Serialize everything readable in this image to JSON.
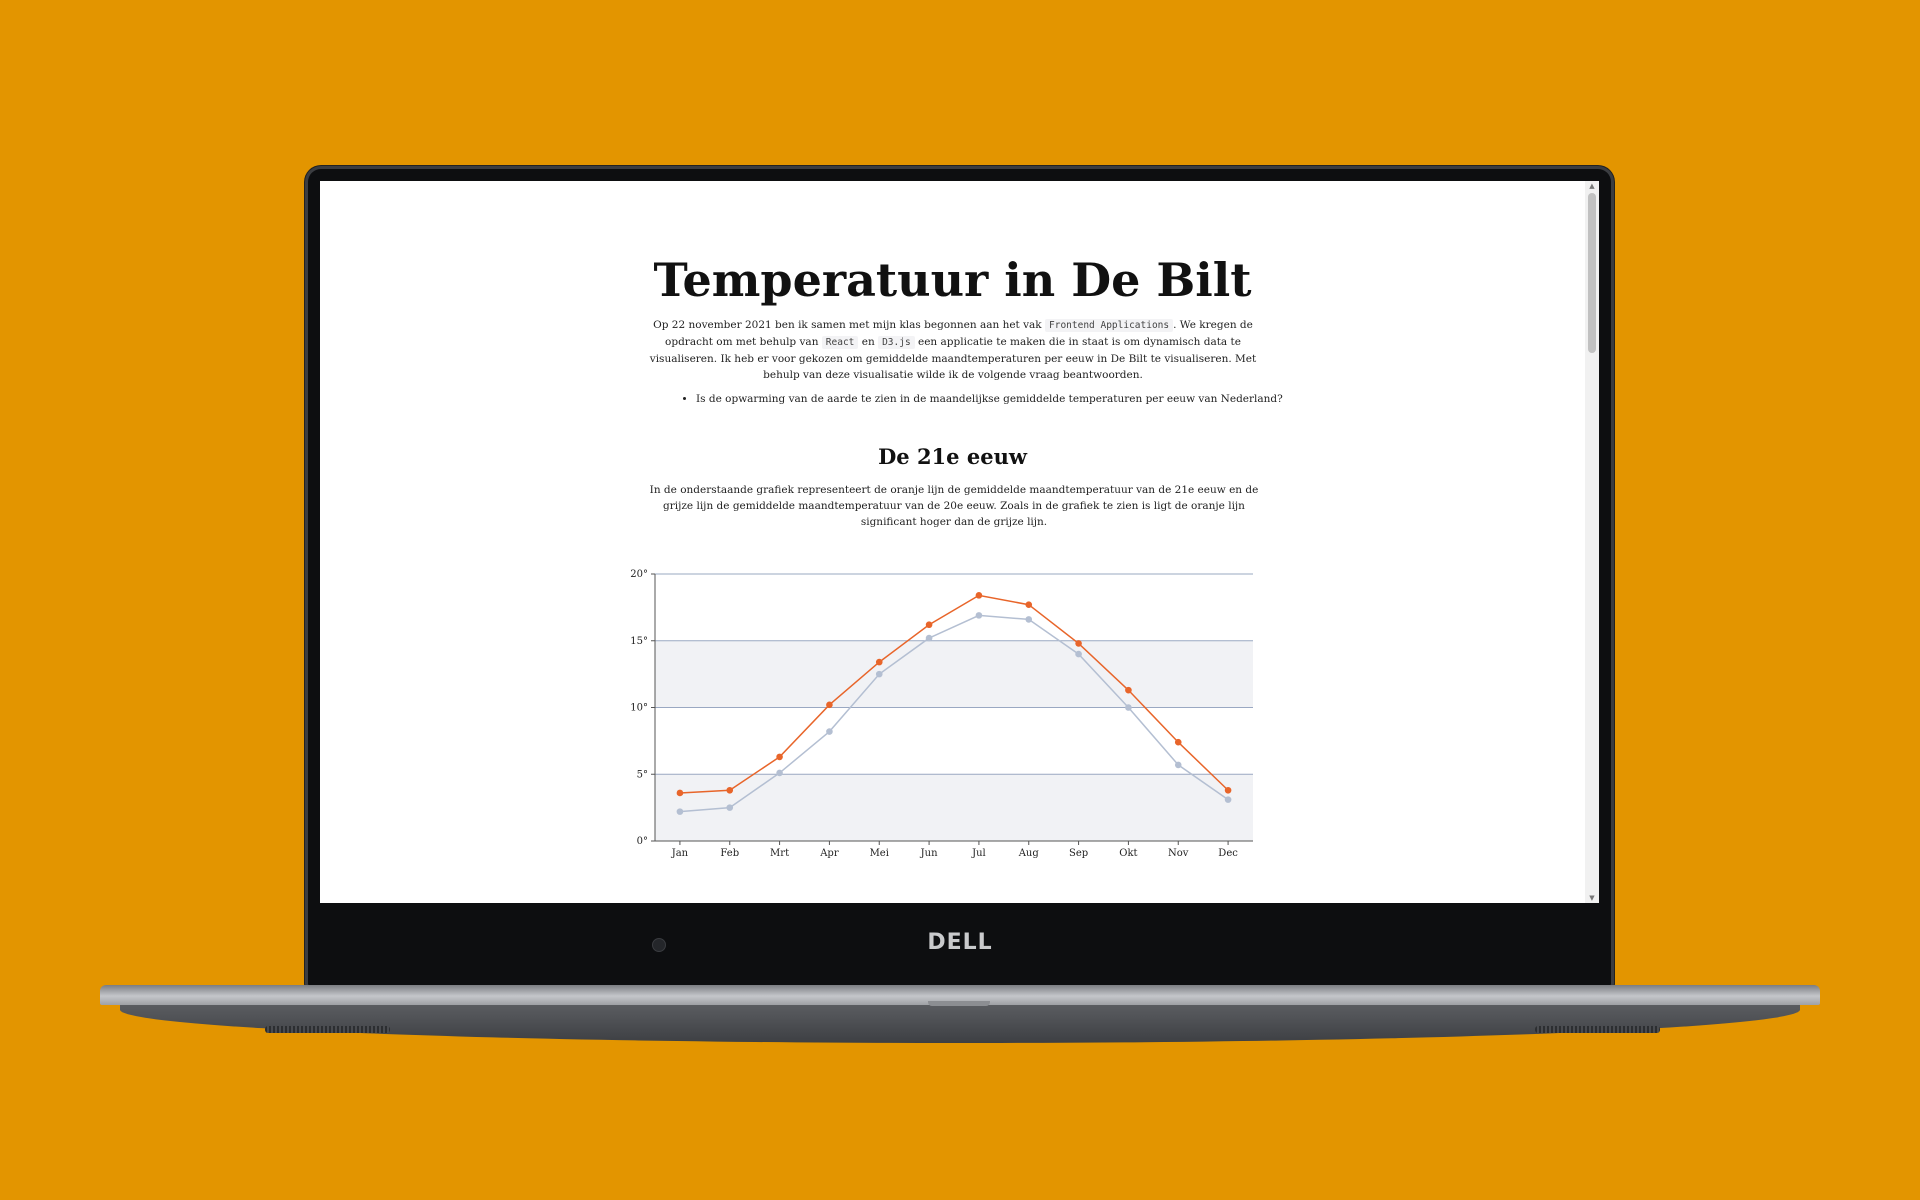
{
  "page": {
    "title": "Temperatuur in De Bilt",
    "intro": {
      "before_code1": "Op 22 november 2021 ben ik samen met mijn klas begonnen aan het vak ",
      "code1": "Frontend Applications",
      "after_code1": ". We kregen de opdracht om met behulp van ",
      "code2": "React",
      "between": " en ",
      "code3": "D3.js",
      "after_code3": " een applicatie te maken die in staat is om dynamisch data te visualiseren. Ik heb er voor gekozen om gemiddelde maandtemperaturen per eeuw in De Bilt te visualiseren. Met behulp van deze visualisatie wilde ik de volgende vraag beantwoorden."
    },
    "questions": [
      "Is de opwarming van de aarde te zien in de maandelijkse gemiddelde temperaturen per eeuw van Nederland?"
    ],
    "section_title": "De 21e eeuw",
    "section_text": "In de onderstaande grafiek representeert de oranje lijn de gemiddelde maandtemperatuur van de 21e eeuw en de grijze lijn de gemiddelde maandtemperatuur van de 20e eeuw. Zoals in de grafiek te zien is ligt de oranje lijn significant hoger dan de grijze lijn."
  },
  "device": {
    "brand": "DELL"
  },
  "colors": {
    "background": "#E39500",
    "line_21e_eeuw": "#E8652A",
    "line_20e_eeuw": "#B4BFD2",
    "band": "#F1F2F5",
    "gridline": "#9AA8C2"
  },
  "chart_data": {
    "type": "line",
    "categories": [
      "Jan",
      "Feb",
      "Mrt",
      "Apr",
      "Mei",
      "Jun",
      "Jul",
      "Aug",
      "Sep",
      "Okt",
      "Nov",
      "Dec"
    ],
    "series": [
      {
        "key": "21e",
        "color": "#E8652A",
        "values": [
          3.6,
          3.8,
          6.3,
          10.2,
          13.4,
          16.2,
          18.4,
          17.7,
          14.8,
          11.3,
          7.4,
          3.8
        ]
      },
      {
        "key": "20e",
        "color": "#B4BFD2",
        "values": [
          2.2,
          2.5,
          5.1,
          8.2,
          12.5,
          15.2,
          16.9,
          16.6,
          14.0,
          10.0,
          5.7,
          3.1
        ]
      }
    ],
    "yticks": [
      "0°",
      "5°",
      "10°",
      "15°",
      "20°"
    ],
    "ytick_values": [
      0,
      5,
      10,
      15,
      20
    ],
    "ylim": [
      0,
      20
    ],
    "title": "",
    "xlabel": "",
    "ylabel": "",
    "grid": true,
    "bands": [
      [
        10,
        15
      ],
      [
        0,
        5
      ]
    ]
  }
}
